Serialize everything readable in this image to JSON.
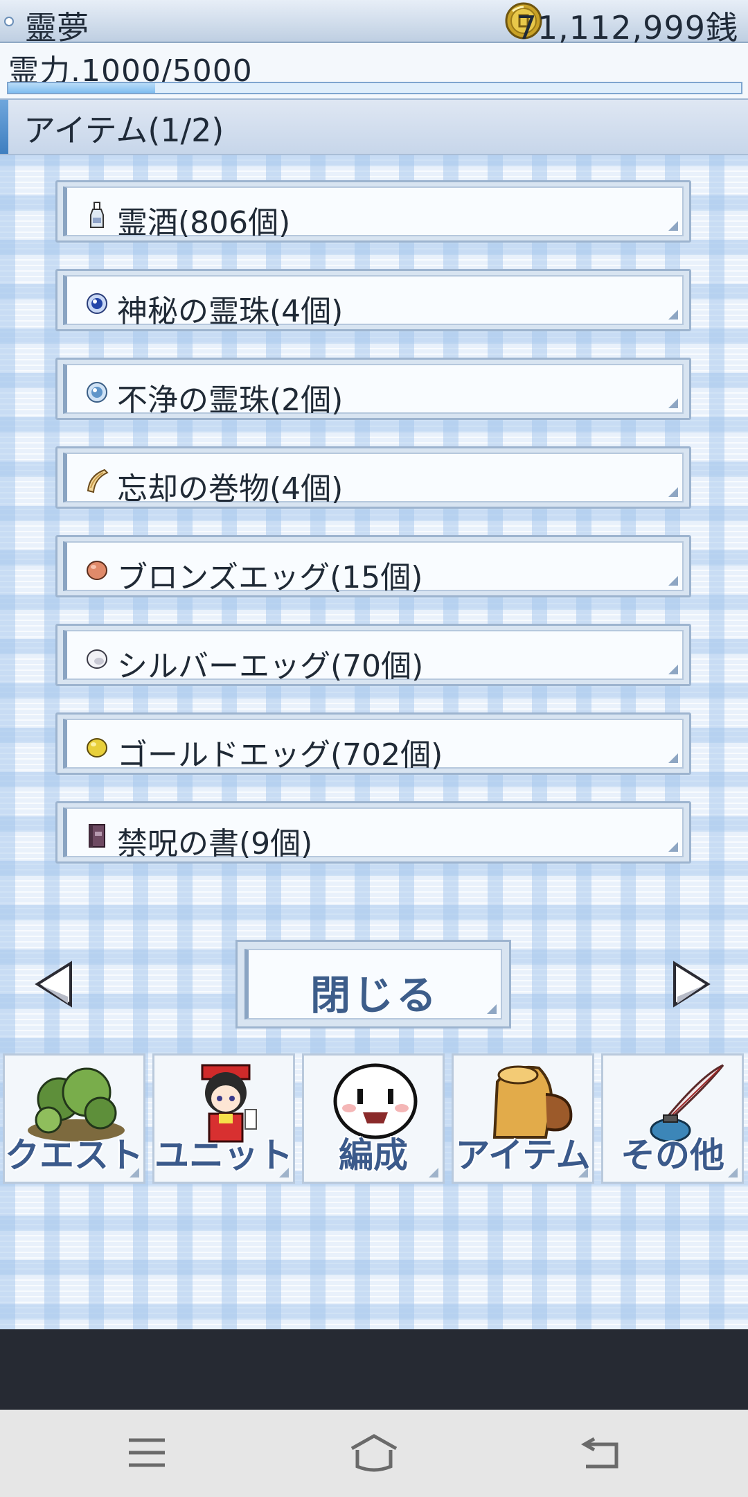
{
  "header": {
    "character_name": "靈夢",
    "money": "71,112,999銭",
    "power_text": "霊力.1000/5000",
    "power_fraction": 0.2
  },
  "section": {
    "title": "アイテム(1/2)"
  },
  "items": [
    {
      "label": "霊酒(806個)",
      "icon": "bottle-icon"
    },
    {
      "label": "神秘の霊珠(4個)",
      "icon": "blue-orb-icon"
    },
    {
      "label": "不浄の霊珠(2個)",
      "icon": "light-orb-icon"
    },
    {
      "label": "忘却の巻物(4個)",
      "icon": "scroll-icon"
    },
    {
      "label": "ブロンズエッグ(15個)",
      "icon": "bronze-egg-icon"
    },
    {
      "label": "シルバーエッグ(70個)",
      "icon": "silver-egg-icon"
    },
    {
      "label": "ゴールドエッグ(702個)",
      "icon": "gold-egg-icon"
    },
    {
      "label": "禁呪の書(9個)",
      "icon": "book-icon"
    }
  ],
  "pager": {
    "close_label": "閉じる",
    "prev_icon": "arrow-left-icon",
    "next_icon": "arrow-right-icon"
  },
  "menu": [
    {
      "label": "クエスト",
      "icon": "forest-icon"
    },
    {
      "label": "ユニット",
      "icon": "shrine-maiden-icon"
    },
    {
      "label": "編成",
      "icon": "yukkuri-face-icon"
    },
    {
      "label": "アイテム",
      "icon": "bag-icon"
    },
    {
      "label": "その他",
      "icon": "quill-ink-icon"
    }
  ],
  "system_nav": [
    "menu-icon",
    "home-icon",
    "back-icon"
  ],
  "colors": {
    "accent": "#3d5d8a",
    "gauge": "#7fbdf0",
    "background": "#e9f1fb"
  }
}
